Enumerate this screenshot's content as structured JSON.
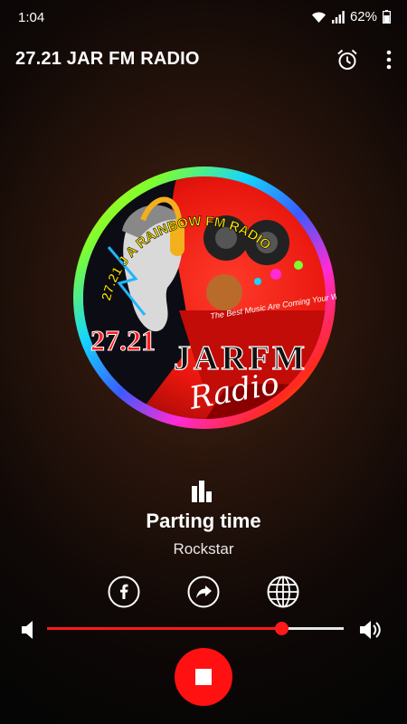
{
  "status": {
    "time": "1:04",
    "battery": "62%",
    "icons": [
      "wifi-icon",
      "signal-icon",
      "battery-icon"
    ]
  },
  "app_bar": {
    "title": "27.21 JAR FM RADIO",
    "icons": [
      "alarm-icon",
      "more-vert-icon"
    ]
  },
  "logo": {
    "arc_text": "27.21 J A RAINBOW FM RADIO",
    "tagline": "The Best Music Are Coming Your Way",
    "frequency": "27.21",
    "brand": "JARFM",
    "sub": "Radio"
  },
  "now_playing": {
    "icon": "equalizer-bars-icon",
    "title": "Parting time",
    "artist": "Rockstar"
  },
  "social": [
    "facebook-icon",
    "share-icon",
    "globe-icon"
  ],
  "volume": {
    "level": 0.79,
    "icons": [
      "volume-low-icon",
      "volume-high-icon"
    ]
  },
  "player": {
    "control_icon": "stop-icon"
  },
  "colors": {
    "accent": "#ff1a1a",
    "track": "#e6e6e6",
    "background": "#0f0806"
  }
}
